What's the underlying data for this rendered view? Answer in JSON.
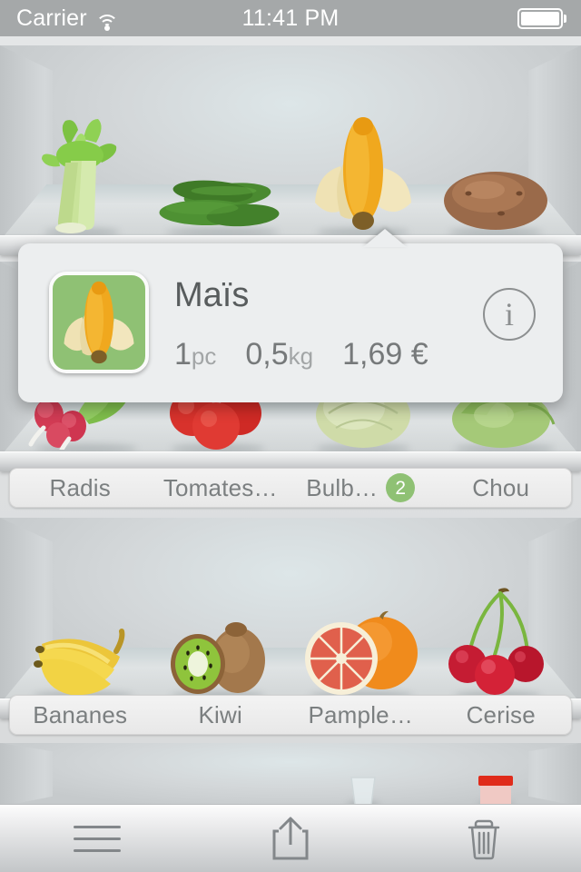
{
  "status_bar": {
    "carrier": "Carrier",
    "wifi_icon": "wifi-icon",
    "time": "11:41 PM",
    "battery_icon": "battery-full-icon"
  },
  "popup": {
    "title": "Maïs",
    "thumbnail_icon": "corn-thumbnail",
    "thumbnail_bg": "#8fc174",
    "quantity_value": "1",
    "quantity_unit": "pc",
    "weight_value": "0,5",
    "weight_unit": "kg",
    "price": "1,69 €",
    "info_icon": "i"
  },
  "shelves": [
    {
      "name": "vegetables-top",
      "items": [
        {
          "name": "celery",
          "icon": "celery-icon"
        },
        {
          "name": "cucumbers",
          "icon": "cucumber-icon"
        },
        {
          "name": "corn",
          "icon": "corn-icon"
        },
        {
          "name": "potato",
          "icon": "potato-icon"
        }
      ]
    },
    {
      "name": "vegetables-second",
      "items": [
        {
          "name": "radishes",
          "icon": "radish-icon"
        },
        {
          "name": "tomatoes",
          "icon": "tomato-icon"
        },
        {
          "name": "fennel-bulb",
          "icon": "fennel-icon"
        },
        {
          "name": "cabbage",
          "icon": "cabbage-icon"
        }
      ],
      "labels": [
        {
          "text": "Radis",
          "badge": null
        },
        {
          "text": "Tomates…",
          "badge": null
        },
        {
          "text": "Bulb…",
          "badge": "2"
        },
        {
          "text": "Chou",
          "badge": null
        }
      ]
    },
    {
      "name": "fruits",
      "items": [
        {
          "name": "bananas",
          "icon": "banana-icon"
        },
        {
          "name": "kiwi",
          "icon": "kiwi-icon"
        },
        {
          "name": "grapefruit",
          "icon": "grapefruit-icon"
        },
        {
          "name": "cherries",
          "icon": "cherry-icon"
        }
      ],
      "labels": [
        {
          "text": "Bananes",
          "badge": null
        },
        {
          "text": "Kiwi",
          "badge": null
        },
        {
          "text": "Pample…",
          "badge": null
        },
        {
          "text": "Cerise",
          "badge": null
        }
      ]
    },
    {
      "name": "drinks-bottom",
      "items": [
        {
          "name": "glass",
          "icon": "glass-icon"
        },
        {
          "name": "jar",
          "icon": "jar-icon"
        }
      ]
    }
  ],
  "toolbar": {
    "menu_icon": "hamburger-menu-icon",
    "share_icon": "share-export-icon",
    "delete_icon": "trash-icon"
  },
  "colors": {
    "badge_green": "#8fc174",
    "label_text": "#7b7f80",
    "popup_bg": "#eceeef"
  }
}
